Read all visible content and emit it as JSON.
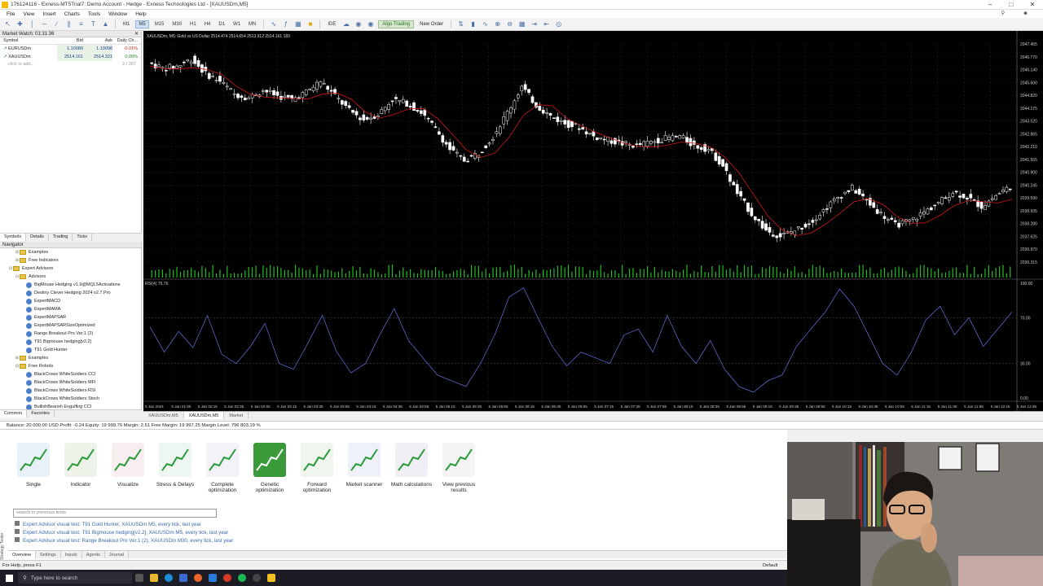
{
  "window": {
    "title": "176124116 - Exness-MT5Trial7: Demo Account - Hedge - Exness Technologies Ltd - [XAUUSDm,M5]"
  },
  "menu": [
    "File",
    "View",
    "Insert",
    "Charts",
    "Tools",
    "Window",
    "Help"
  ],
  "toolbar": {
    "timeframes": [
      "M1",
      "M5",
      "M15",
      "M30",
      "H1",
      "H4",
      "D1",
      "W1",
      "MN"
    ],
    "active_timeframe": "M5",
    "ide_label": "IDE",
    "algo_label": "Algo Trading",
    "new_order_label": "New Order"
  },
  "market_watch": {
    "header": "Market Watch: 01:31:36",
    "columns": [
      "Symbol",
      "Bid",
      "Ask",
      "Daily Ch..."
    ],
    "rows": [
      {
        "symbol": "EURUSDm",
        "bid": "1.10089",
        "ask": "1.10098",
        "change": "-0.01%"
      },
      {
        "symbol": "XAUUSDm",
        "bid": "2514.161",
        "ask": "2514.321",
        "change": "0.09%"
      }
    ],
    "add_label": "click to add...",
    "count": "2 / 397",
    "tabs": [
      "Symbols",
      "Details",
      "Trading",
      "Ticks"
    ]
  },
  "navigator": {
    "header": "Navigator",
    "items": [
      {
        "label": "Examples",
        "indent": 2,
        "type": "folder",
        "exp": "+"
      },
      {
        "label": "Free Indicators",
        "indent": 2,
        "type": "folder",
        "exp": "+"
      },
      {
        "label": "Expert Advisors",
        "indent": 1,
        "type": "folder",
        "exp": "-"
      },
      {
        "label": "Advisors",
        "indent": 2,
        "type": "folder",
        "exp": "-"
      },
      {
        "label": "BigMouse Hedging v1.9@MQL5Activations",
        "indent": 3,
        "type": "robot",
        "exp": ""
      },
      {
        "label": "Destiny Clever Hedging 2024 v2.7.Pro",
        "indent": 3,
        "type": "robot",
        "exp": ""
      },
      {
        "label": "ExpertMACD",
        "indent": 3,
        "type": "robot",
        "exp": ""
      },
      {
        "label": "ExpertMAMA",
        "indent": 3,
        "type": "robot",
        "exp": ""
      },
      {
        "label": "ExpertMAPSAR",
        "indent": 3,
        "type": "robot",
        "exp": ""
      },
      {
        "label": "ExpertMAPSARSizeOptimized",
        "indent": 3,
        "type": "robot",
        "exp": ""
      },
      {
        "label": "Range Breakout Pro Ver.1 (2)",
        "indent": 3,
        "type": "robot",
        "exp": ""
      },
      {
        "label": "T91 Bigmouse hedging[v2.2]",
        "indent": 3,
        "type": "robot",
        "exp": ""
      },
      {
        "label": "T91 Gold Hunter",
        "indent": 3,
        "type": "robot",
        "exp": ""
      },
      {
        "label": "Examples",
        "indent": 2,
        "type": "folder",
        "exp": "+"
      },
      {
        "label": "Free Robots",
        "indent": 2,
        "type": "folder",
        "exp": "-"
      },
      {
        "label": "BlackCrows WhiteSoldiers CCI",
        "indent": 3,
        "type": "robot",
        "exp": ""
      },
      {
        "label": "BlackCrows WhiteSoldiers MFI",
        "indent": 3,
        "type": "robot",
        "exp": ""
      },
      {
        "label": "BlackCrows WhiteSoldiers RSI",
        "indent": 3,
        "type": "robot",
        "exp": ""
      },
      {
        "label": "BlackCrows WhiteSoldiers Stoch",
        "indent": 3,
        "type": "robot",
        "exp": ""
      },
      {
        "label": "BullishBearish Engulfing CCI",
        "indent": 3,
        "type": "robot",
        "exp": ""
      }
    ],
    "tabs": [
      "Common",
      "Favorites"
    ]
  },
  "chart": {
    "symbol_info": "XAUUSDm, M5: Gold vs US Dollar  2514.474 2514.654 2513.912 2514.161 183",
    "price_labels": [
      "2047.455",
      "2046.770",
      "2046.140",
      "2045.600",
      "2044.820",
      "2044.175",
      "2043.520",
      "2042.865",
      "2042.210",
      "2041.555",
      "2040.900",
      "2040.245",
      "2039.590",
      "2038.935",
      "2038.280",
      "2037.625",
      "2036.970",
      "2036.315"
    ],
    "rsi_label": "RSI(4) 75.76",
    "rsi_levels": [
      "100.00",
      "70.00",
      "30.00",
      "0.00"
    ],
    "time_labels": [
      "5 Jan 2024",
      "5 Jan 01:55",
      "5 Jan 02:15",
      "5 Jan 02:35",
      "5 Jan 02:55",
      "5 Jan 03:15",
      "5 Jan 03:35",
      "5 Jan 03:55",
      "5 Jan 04:15",
      "5 Jan 04:35",
      "5 Jan 04:55",
      "5 Jan 05:15",
      "5 Jan 05:35",
      "5 Jan 05:55",
      "5 Jan 06:15",
      "5 Jan 06:35",
      "5 Jan 06:55",
      "5 Jan 07:15",
      "5 Jan 07:35",
      "5 Jan 07:55",
      "5 Jan 08:15",
      "5 Jan 08:35",
      "5 Jan 08:55",
      "5 Jan 09:15",
      "5 Jan 09:35",
      "5 Jan 09:55",
      "5 Jan 10:15",
      "5 Jan 10:35",
      "5 Jan 10:55",
      "5 Jan 11:15",
      "5 Jan 11:35",
      "5 Jan 11:55",
      "5 Jan 12:15",
      "5 Jan 12:35"
    ],
    "tabs": [
      "XAUUSDm,M5",
      "XAUUSDm,M5",
      "Market"
    ],
    "colors": {
      "candle": "#ffffff",
      "ma": "#d01818",
      "volume": "#1fbf1f",
      "rsi": "#5a66c8",
      "grid": "#3a3a3a"
    }
  },
  "chart_data": {
    "type": "line",
    "ylim": [
      2036.0,
      2048.0
    ],
    "x": [
      0,
      4,
      8,
      12,
      16,
      20,
      24,
      28,
      32,
      36,
      40,
      44,
      48,
      52,
      56,
      60,
      64,
      68,
      72,
      76,
      80,
      84,
      88,
      92,
      96,
      100,
      104,
      108,
      112,
      116,
      120,
      124,
      128,
      132,
      136,
      140,
      144,
      148,
      152,
      156,
      160,
      164,
      168,
      172,
      176,
      180,
      184,
      188,
      192,
      196,
      200,
      204,
      208,
      212,
      216,
      220,
      224,
      228,
      232,
      236,
      240
    ],
    "series": [
      {
        "values": [
          2046.9,
          2046.6,
          2046.7,
          2047.1,
          2046.3,
          2045.9,
          2045.2,
          2045.0,
          2045.4,
          2045.1,
          2044.9,
          2045.3,
          2045.9,
          2045.1,
          2044.3,
          2043.8,
          2044.1,
          2044.9,
          2044.7,
          2044.2,
          2043.3,
          2042.2,
          2041.6,
          2042.0,
          2042.9,
          2044.2,
          2045.6,
          2044.6,
          2044.0,
          2043.6,
          2043.4,
          2042.9,
          2042.7,
          2042.5,
          2042.4,
          2042.6,
          2042.8,
          2042.9,
          2042.4,
          2042.2,
          2041.3,
          2039.8,
          2038.7,
          2037.8,
          2037.5,
          2037.8,
          2038.2,
          2038.9,
          2039.6,
          2040.1,
          2039.4,
          2038.7,
          2038.1,
          2038.3,
          2038.8,
          2039.3,
          2039.9,
          2039.6,
          2039.1,
          2039.7,
          2040.2
        ]
      }
    ],
    "rsi": {
      "ylim": [
        0,
        100
      ],
      "x": [
        0,
        4,
        8,
        12,
        16,
        20,
        24,
        28,
        32,
        36,
        40,
        44,
        48,
        52,
        56,
        60,
        64,
        68,
        72,
        76,
        80,
        84,
        88,
        92,
        96,
        100,
        104,
        108,
        112,
        116,
        120,
        124,
        128,
        132,
        136,
        140,
        144,
        148,
        152,
        156,
        160,
        164,
        168,
        172,
        176,
        180,
        184,
        188,
        192,
        196,
        200,
        204,
        208,
        212,
        216,
        220,
        224,
        228,
        232,
        236,
        240
      ],
      "values": [
        62,
        40,
        58,
        44,
        72,
        38,
        30,
        45,
        65,
        30,
        25,
        48,
        72,
        40,
        22,
        30,
        55,
        78,
        50,
        35,
        20,
        15,
        10,
        30,
        55,
        88,
        96,
        70,
        45,
        28,
        40,
        35,
        30,
        55,
        60,
        40,
        72,
        45,
        30,
        50,
        25,
        10,
        5,
        15,
        20,
        45,
        60,
        75,
        95,
        80,
        55,
        30,
        20,
        40,
        68,
        80,
        55,
        70,
        45,
        60,
        75
      ]
    }
  },
  "account": {
    "status_line": "Balance: 20 000.00 USD  Profit: -0.24  Equity: 19 999.76  Margin: 2.51  Free Margin: 19 997.25  Margin Level: 796 803.19 %"
  },
  "tester": {
    "vertical_label": "Strategy Tester",
    "modes": [
      "Single",
      "Indicator",
      "Visualize",
      "Stress & Delays",
      "Complete optimization",
      "Genetic optimization",
      "Forward optimization",
      "Market scanner",
      "Math calculations",
      "View previous results"
    ],
    "search_placeholder": "search in previous tests",
    "history": [
      "Expert Advisor visual test: T91 Gold Hunter, XAUUSDm M5, every tick, last year",
      "Expert Advisor visual test: T91 Bigmouse hedging[v2.2], XAUUSDm M5, every tick, last year",
      "Expert Advisor visual test: Range Breakout Pro Ver.1 (2), XAUUSDm M30, every tick, last year"
    ],
    "tabs": [
      "Overview",
      "Settings",
      "Inputs",
      "Agents",
      "Journal"
    ]
  },
  "statusbar": {
    "help": "For Help, press F1",
    "profile": "Default"
  },
  "taskbar": {
    "search_placeholder": "Type here to search"
  }
}
